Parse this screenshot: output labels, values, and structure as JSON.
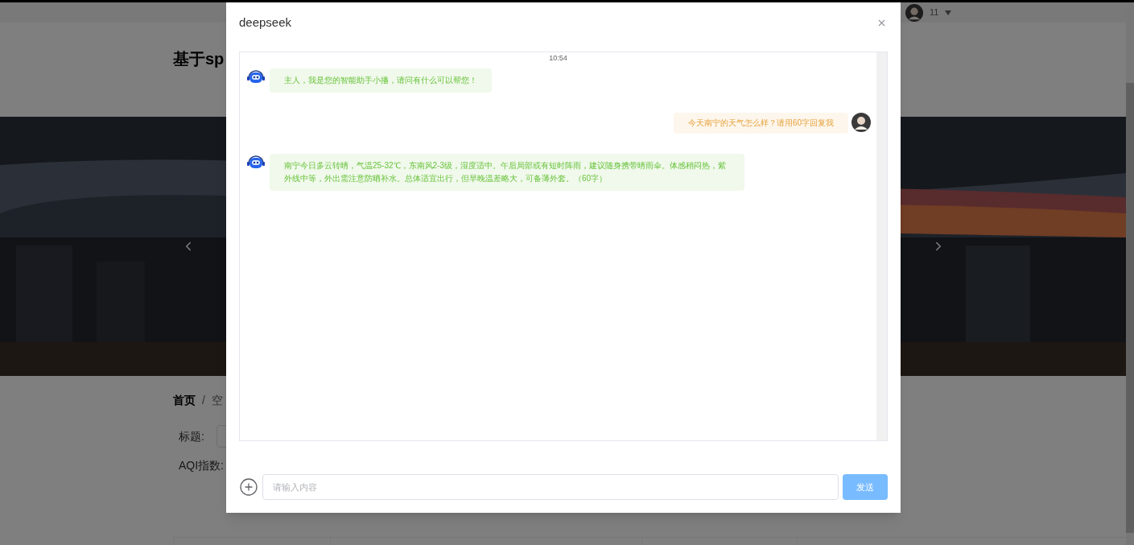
{
  "header": {
    "user_name": "11"
  },
  "page": {
    "title": "基于sp",
    "breadcrumb": [
      "首页",
      "空"
    ],
    "separator": "/",
    "form_labels": [
      "标题:",
      "AQI指数:"
    ]
  },
  "dialog": {
    "title": "deepseek",
    "timestamp": "10:54",
    "messages": [
      {
        "kind": "bot",
        "text": "主人，我是您的智能助手小播，请问有什么可以帮您！"
      },
      {
        "kind": "user",
        "text": "今天南宁的天气怎么样？请用60字回复我"
      },
      {
        "kind": "bot",
        "text": "南宁今日多云转晴，气温25-32℃，东南风2-3级，湿度适中。午后局部或有短时阵雨，建议随身携带晴雨伞。体感稍闷热，紫外线中等，外出需注意防晒补水。总体适宜出行，但早晚温差略大，可备薄外套。（60字）"
      }
    ],
    "input": {
      "placeholder": "请输入内容"
    },
    "send_button": "发送"
  }
}
